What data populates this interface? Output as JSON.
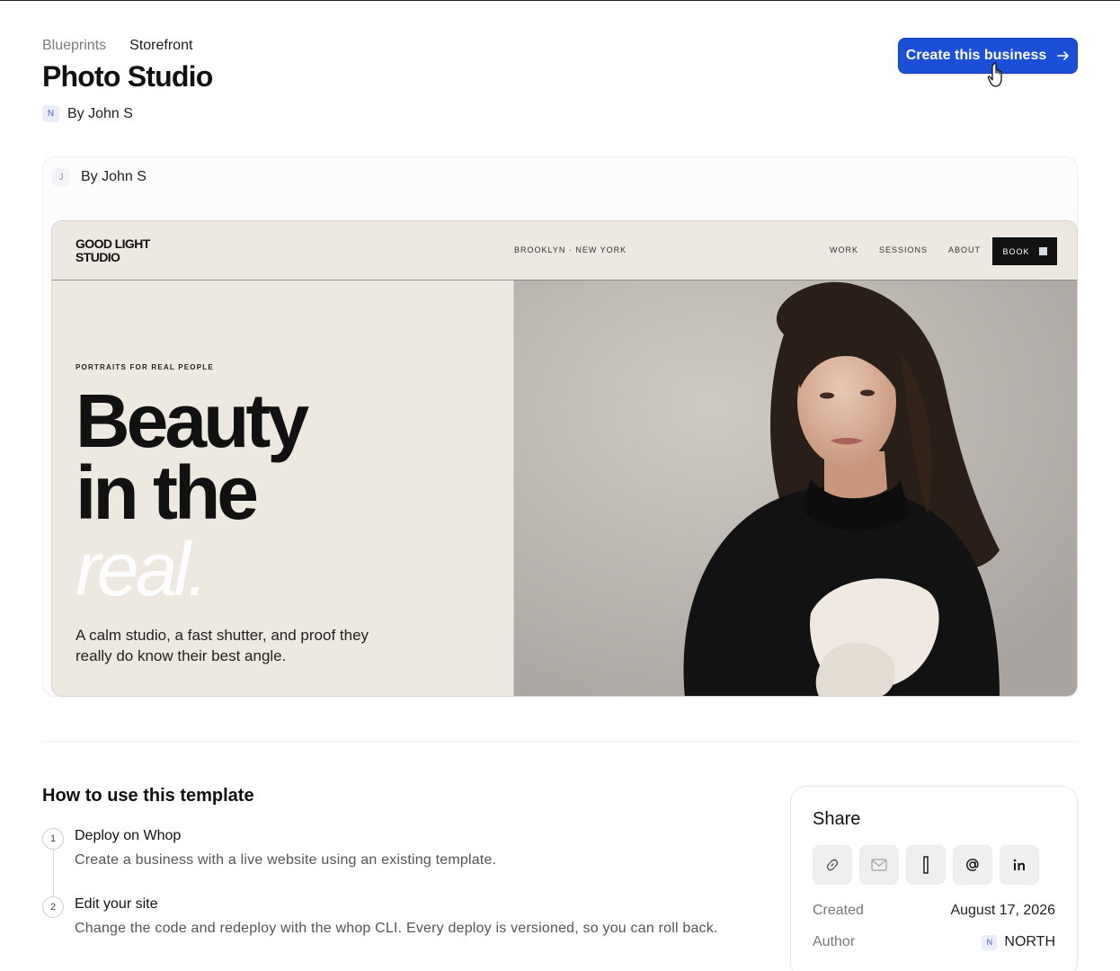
{
  "breadcrumb": [
    "Blueprints",
    "Storefront"
  ],
  "title": "Photo Studio",
  "author": {
    "initial": "N",
    "label": "By John S"
  },
  "cta": {
    "label": "Create this business",
    "icon": "arrow-right-icon"
  },
  "preview": {
    "byline": {
      "initial": "J",
      "label": "By John S"
    },
    "site": {
      "logo_line1": "GOOD LIGHT",
      "logo_line2": "STUDIO",
      "location": "BROOKLYN · NEW YORK",
      "nav": [
        "WORK",
        "SESSIONS",
        "ABOUT"
      ],
      "book_label": "BOOK",
      "eyebrow": "PORTRAITS FOR REAL PEOPLE",
      "headline_line1": "Beauty",
      "headline_line2": "in the",
      "headline_em": "real.",
      "subtext": "A calm studio, a fast shutter, and proof they really do know their best angle."
    }
  },
  "howto": {
    "title": "How to use this template",
    "steps": [
      {
        "num": "1",
        "title": "Deploy on Whop",
        "desc": "Create a business with a live website using an existing template."
      },
      {
        "num": "2",
        "title": "Edit your site",
        "desc": "Change the code and redeploy with the whop CLI. Every deploy is versioned, so you can roll back."
      }
    ]
  },
  "share": {
    "title": "Share",
    "icons": [
      "link-icon",
      "mail-icon",
      "x-icon",
      "threads-icon",
      "linkedin-icon"
    ],
    "created_label": "Created",
    "created_value": "August 17, 2026",
    "author_label": "Author",
    "author_initial": "N",
    "author_value": "NORTH"
  }
}
